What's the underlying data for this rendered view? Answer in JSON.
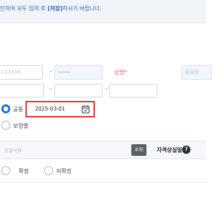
{
  "notice": {
    "prefix": "인하여 모두 입력 후 ",
    "highlight": "[저장]",
    "suffix": "하시기 바랍니다."
  },
  "row1": {
    "masked_value_1": "123456",
    "masked_value_2": "·······",
    "name_label": "성명",
    "required_mark": "*",
    "name_value": "홍길동"
  },
  "dashes": {
    "dash": "-"
  },
  "type_options": [
    {
      "label": "공통",
      "selected": true
    },
    {
      "label": "보험별",
      "selected": false
    }
  ],
  "date_field": {
    "value": "2025-03-01"
  },
  "search_section": {
    "reason_placeholder": "상실사유",
    "query_label": "조회",
    "status_label": "자격상실일",
    "help_label": "?"
  },
  "confirm_options": [
    {
      "label": "확정",
      "selected": false
    },
    {
      "label": "미확정",
      "selected": false
    }
  ],
  "colors": {
    "accent": "#1a6fd1",
    "highlight_border": "#e02a2a",
    "notice_text": "#2b62b0"
  }
}
